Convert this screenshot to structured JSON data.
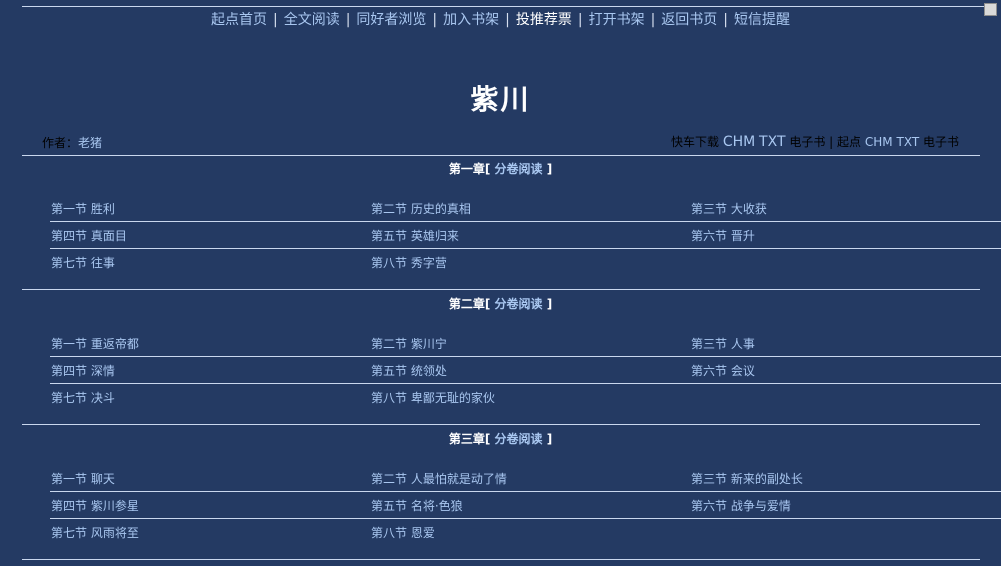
{
  "nav": {
    "home": "起点首页",
    "full_read": "全文阅读",
    "fan_browse": "同好者浏览",
    "add_shelf": "加入书架",
    "vote": "投推荐票",
    "open_shelf": "打开书架",
    "back_page": "返回书页",
    "sms": "短信提醒",
    "separator": "|"
  },
  "book": {
    "title": "紫川",
    "author_label": "作者：",
    "author": "老猪"
  },
  "downloads": {
    "fast_label": "快车下载",
    "fast_chm": "CHM",
    "fast_txt": "TXT",
    "ebook": "电子书",
    "separator": "|",
    "qidian_label": "起点",
    "qidian_chm": "CHM",
    "qidian_txt": "TXT",
    "ebook2": "电子书"
  },
  "volumes": [
    {
      "name": "第一章[",
      "read_label": "分卷阅读",
      "close": "]",
      "chapters": [
        "第一节 胜利",
        "第二节 历史的真相",
        "第三节 大收获",
        "第四节 真面目",
        "第五节 英雄归来",
        "第六节 晋升",
        "第七节 往事",
        "第八节 秀字营"
      ]
    },
    {
      "name": "第二章[",
      "read_label": "分卷阅读",
      "close": "]",
      "chapters": [
        "第一节 重返帝都",
        "第二节 紫川宁",
        "第三节 人事",
        "第四节 深情",
        "第五节 统领处",
        "第六节 会议",
        "第七节 决斗",
        "第八节 卑鄙无耻的家伙"
      ]
    },
    {
      "name": "第三章[",
      "read_label": "分卷阅读",
      "close": "]",
      "chapters": [
        "第一节 聊天",
        "第二节 人最怕就是动了情",
        "第三节 新来的副处长",
        "第四节 紫川参星",
        "第五节 名将·色狼",
        "第六节 战争与爱情",
        "第七节 风雨将至",
        "第八节 恩爱"
      ]
    }
  ]
}
